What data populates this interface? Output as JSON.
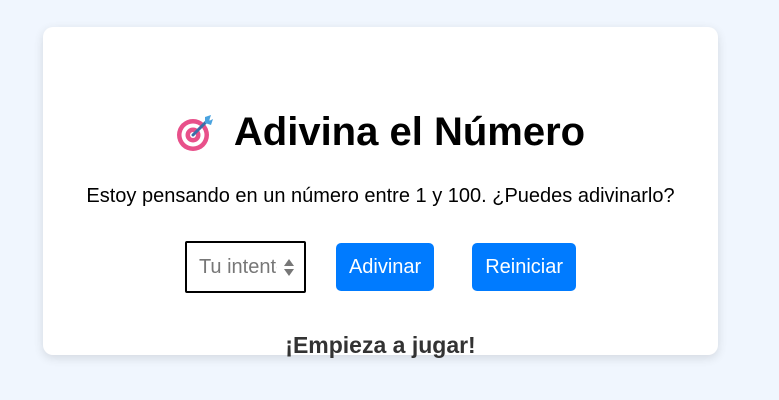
{
  "game": {
    "title": "Adivina el Número",
    "title_icon": "target-dart-icon",
    "subtitle": "Estoy pensando en un número entre 1 y 100. ¿Puedes adivinarlo?",
    "input_placeholder": "Tu intento",
    "guess_label": "Adivinar",
    "reset_label": "Reiniciar",
    "status_message": "¡Empieza a jugar!"
  },
  "colors": {
    "background": "#f0f6fe",
    "card": "#ffffff",
    "button": "#007bff",
    "status_text": "#333333"
  }
}
